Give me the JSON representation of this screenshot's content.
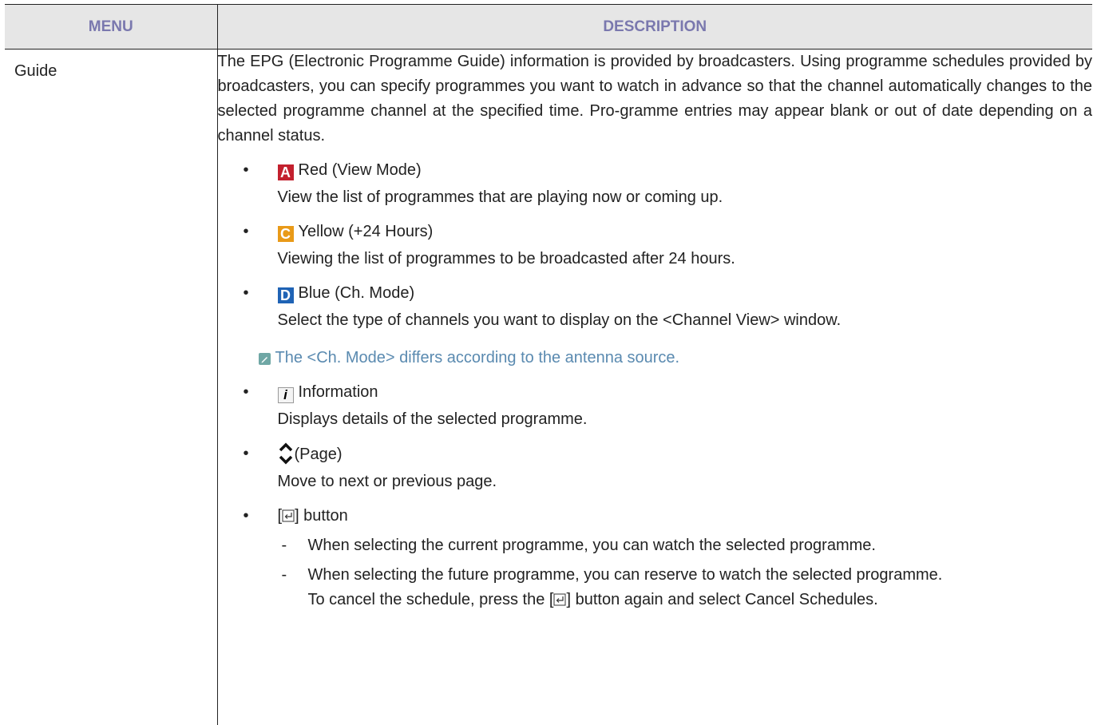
{
  "table": {
    "header_menu": "MENU",
    "header_description": "DESCRIPTION"
  },
  "row": {
    "menu": "Guide",
    "intro": "The EPG (Electronic Programme Guide) information is provided by broadcasters. Using programme schedules provided by broadcasters, you can specify programmes you want to watch in advance so that the channel automatically changes to the selected programme channel at the specified time. Pro-gramme entries may appear blank or out of date depending on a channel status.",
    "items": [
      {
        "key": "A",
        "title": "Red (View Mode)",
        "desc": "View the list of programmes that are playing now or coming up."
      },
      {
        "key": "C",
        "title": "Yellow (+24 Hours)",
        "desc": "Viewing the list of programmes to be broadcasted after 24 hours."
      },
      {
        "key": "D",
        "title": "Blue (Ch. Mode)",
        "desc": "Select the type of channels you want to display on the <Channel View> window."
      }
    ],
    "note": "The <Ch. Mode> differs according to the antenna source.",
    "info": {
      "key": "i",
      "title": "Information",
      "desc": "Displays details of the selected programme."
    },
    "page": {
      "title": "(Page)",
      "desc": "Move to next or previous page."
    },
    "enter": {
      "title_prefix": "[",
      "title_suffix": "] button",
      "sub1": "When selecting the current programme, you can watch the selected programme.",
      "sub2_line1": "When selecting the future programme, you can reserve to watch the selected programme.",
      "sub2_line2_prefix": "To cancel the schedule, press the [",
      "sub2_line2_suffix": "] button again and select Cancel Schedules."
    },
    "bullet_char": "•",
    "dash_char": "-"
  },
  "colors": {
    "header_text": "#7a78ae",
    "header_bg": "#e6e6e6",
    "note_text": "#5a8ab0",
    "key_red": "#c3202e",
    "key_yellow": "#e99a18",
    "key_blue": "#1f63b5"
  },
  "icons": [
    "red-a-key-icon",
    "yellow-c-key-icon",
    "blue-d-key-icon",
    "note-pencil-icon",
    "info-key-icon",
    "page-up-down-icon",
    "enter-button-icon"
  ]
}
